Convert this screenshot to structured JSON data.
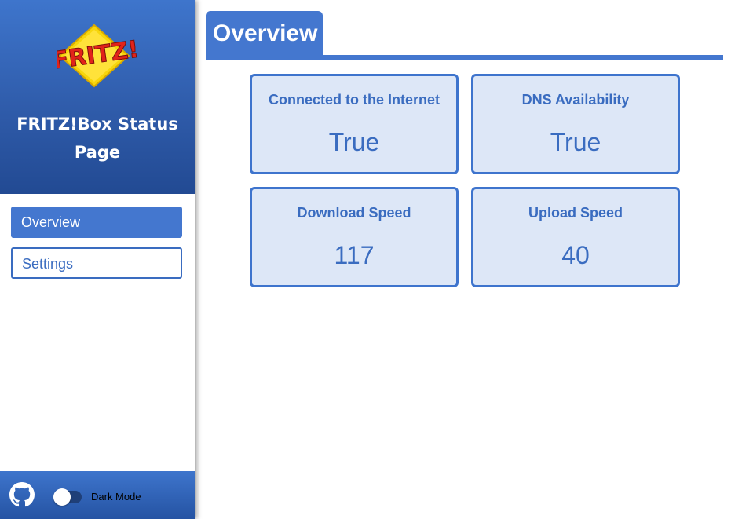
{
  "sidebar": {
    "logo_text": "FRITZ!",
    "title": "FRITZ!Box Status Page",
    "nav": [
      {
        "label": "Overview",
        "active": true
      },
      {
        "label": "Settings",
        "active": false
      }
    ],
    "footer": {
      "github_icon": "github-icon",
      "dark_mode_label": "Dark Mode",
      "dark_mode_on": false
    }
  },
  "main": {
    "title": "Overview",
    "cards": [
      {
        "label": "Connected to the Internet",
        "value": "True"
      },
      {
        "label": "DNS Availability",
        "value": "True"
      },
      {
        "label": "Download Speed",
        "value": "117"
      },
      {
        "label": "Upload Speed",
        "value": "40"
      }
    ]
  },
  "colors": {
    "accent": "#4477cf",
    "card_bg": "#dde7f7",
    "text_blue": "#3a6cc0"
  }
}
